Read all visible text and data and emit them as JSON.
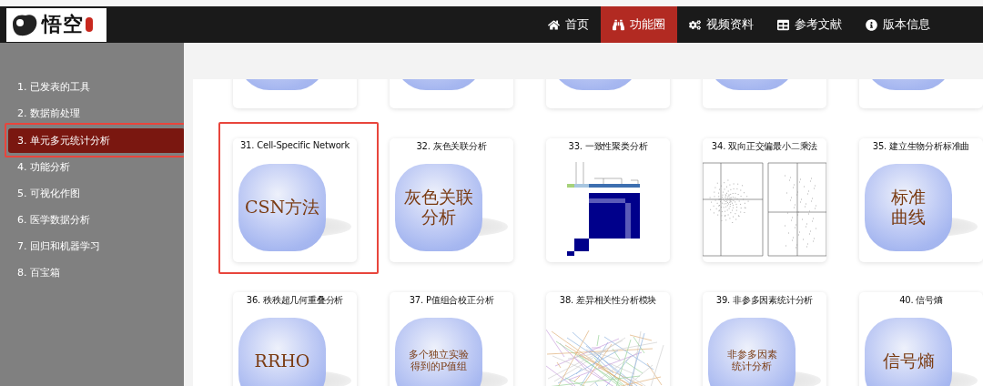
{
  "logo": {
    "text": "悟空"
  },
  "nav": [
    {
      "label": "首页",
      "selected": false
    },
    {
      "label": "功能圈",
      "selected": true
    },
    {
      "label": "视频资料",
      "selected": false
    },
    {
      "label": "参考文献",
      "selected": false
    },
    {
      "label": "版本信息",
      "selected": false
    }
  ],
  "sidebar": {
    "items": [
      {
        "label": "1. 已发表的工具",
        "selected": false,
        "highlighted": false
      },
      {
        "label": "2. 数据前处理",
        "selected": false,
        "highlighted": false
      },
      {
        "label": "3. 单元多元统计分析",
        "selected": true,
        "highlighted": true
      },
      {
        "label": "4. 功能分析",
        "selected": false,
        "highlighted": false
      },
      {
        "label": "5. 可视化作图",
        "selected": false,
        "highlighted": false
      },
      {
        "label": "6. 医学数据分析",
        "selected": false,
        "highlighted": false
      },
      {
        "label": "7. 回归和机器学习",
        "selected": false,
        "highlighted": false
      },
      {
        "label": "8. 百宝箱",
        "selected": false,
        "highlighted": false
      }
    ]
  },
  "cards": [
    {
      "kind": "bubble",
      "highlighted": false
    },
    {
      "kind": "bubble",
      "highlighted": false
    },
    {
      "kind": "bubble",
      "highlighted": false
    },
    {
      "kind": "bubble",
      "highlighted": false
    },
    {
      "kind": "bubble",
      "highlighted": false
    },
    {
      "kind": "bubble",
      "title": "31. Cell-Specific Network",
      "lines": [
        "CSN方法"
      ],
      "highlighted": true
    },
    {
      "kind": "bubble",
      "title": "32. 灰色关联分析",
      "lines": [
        "灰色关联",
        "分析"
      ],
      "highlighted": false
    },
    {
      "kind": "heatmap",
      "title": "33. 一致性聚类分析",
      "highlighted": false
    },
    {
      "kind": "scatter",
      "title": "34. 双向正交偏最小二乘法",
      "highlighted": false
    },
    {
      "kind": "bubble",
      "title": "35. 建立生物分析标准曲",
      "lines": [
        "标准",
        "曲线"
      ],
      "highlighted": false
    },
    {
      "kind": "bubble",
      "title": "36. 秩秩超几何重叠分析",
      "lines": [
        "RRHO"
      ],
      "highlighted": false
    },
    {
      "kind": "bubble",
      "title": "37. P值组合校正分析",
      "lines": [
        "多个独立实验",
        "得到的P值组"
      ],
      "highlighted": false
    },
    {
      "kind": "network",
      "title": "38. 差异相关性分析模块",
      "highlighted": false
    },
    {
      "kind": "bubble",
      "title": "39. 非参多因素统计分析",
      "lines": [
        "非参多因素",
        "统计分析"
      ],
      "highlighted": false
    },
    {
      "kind": "bubble",
      "title": "40. 信号熵",
      "lines": [
        "信号熵"
      ],
      "highlighted": false
    }
  ]
}
